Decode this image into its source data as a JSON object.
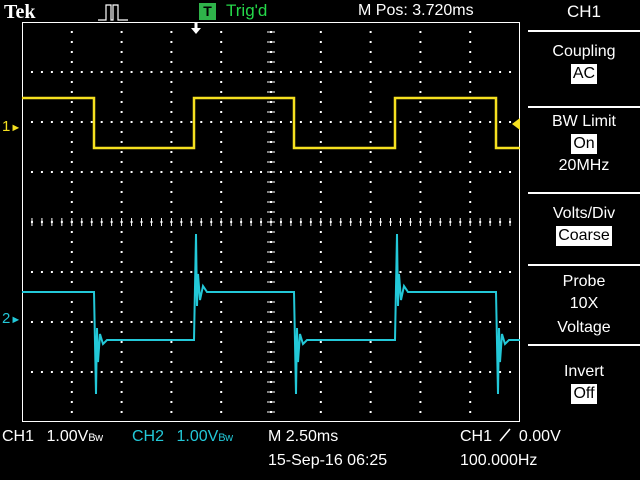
{
  "header": {
    "brand": "Tek",
    "trigger_badge": "T",
    "trigger_status": "Trig'd",
    "horizontal_position": "M Pos: 3.720ms"
  },
  "menu": {
    "title": "CH1",
    "coupling": {
      "label": "Coupling",
      "value": "AC"
    },
    "bw_limit": {
      "label": "BW Limit",
      "value": "On",
      "sub": "20MHz"
    },
    "volts_div": {
      "label": "Volts/Div",
      "value": "Coarse"
    },
    "probe": {
      "label": "Probe",
      "line1": "10X",
      "line2": "Voltage"
    },
    "invert": {
      "label": "Invert",
      "value": "Off"
    }
  },
  "markers": {
    "ch1": "1",
    "ch2": "2"
  },
  "status": {
    "ch1_name": "CH1",
    "ch1_scale": "1.00V",
    "ch1_bw": "Bw",
    "ch2_name": "CH2",
    "ch2_scale": "1.00V",
    "ch2_bw": "Bw",
    "timebase": "M 2.50ms",
    "date_time": "15-Sep-16 06:25",
    "trigger_source": "CH1",
    "trigger_level": "0.00V",
    "frequency": "100.000Hz"
  },
  "colors": {
    "ch1": "#f5e020",
    "ch2": "#23c8d8",
    "grid": "#ffffff",
    "trig_badge": "#2fb34a",
    "trig_text": "#25d94a"
  },
  "waveform": {
    "period_div": 4,
    "duty": 0.5,
    "ch1_high_div": 2.5,
    "ch1_low_div": 1.5
  }
}
